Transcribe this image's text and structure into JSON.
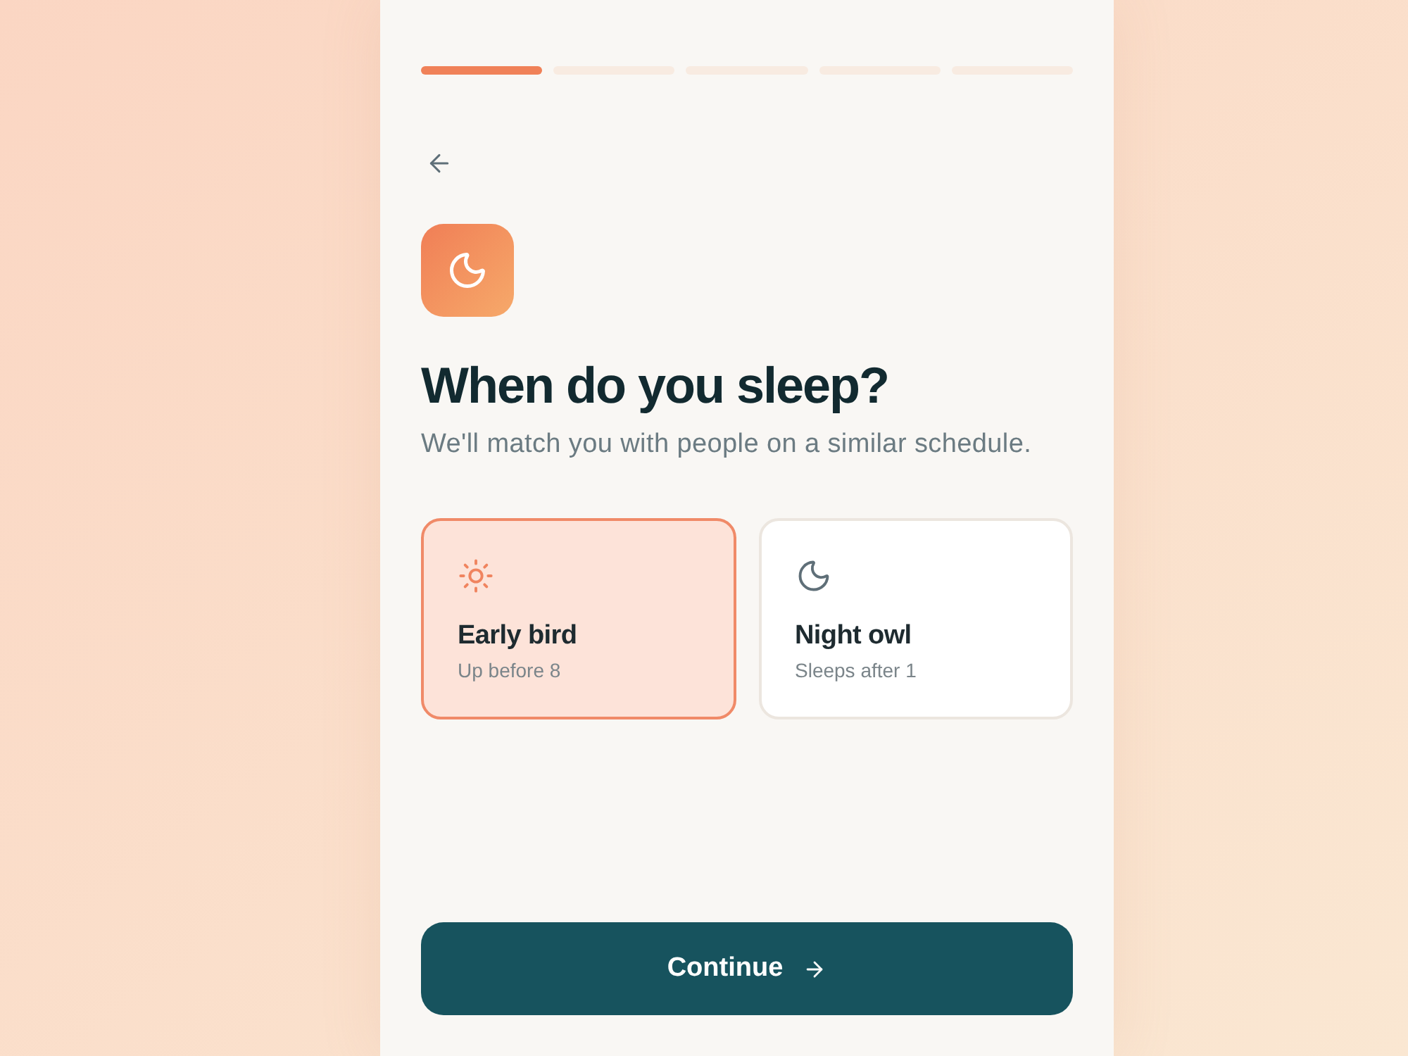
{
  "progress": {
    "steps": [
      {
        "done": true
      },
      {
        "done": false
      },
      {
        "done": false
      },
      {
        "done": false
      },
      {
        "done": false
      }
    ]
  },
  "title": "When do you sleep?",
  "subtitle": "We'll match you with people on a similar schedule.",
  "options": [
    {
      "kind": "day",
      "title": "Early bird",
      "subtitle": "Up before 8",
      "selected": true
    },
    {
      "kind": "night",
      "title": "Night owl",
      "subtitle": "Sleeps after 1",
      "selected": false
    }
  ],
  "continue_button": {
    "label": "Continue"
  }
}
